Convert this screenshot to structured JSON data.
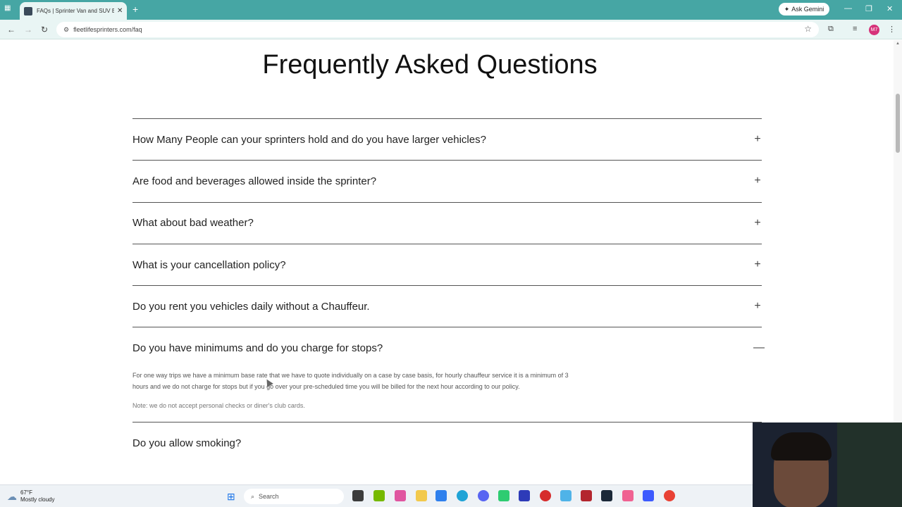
{
  "browser": {
    "tab_title": "FAQs | Sprinter Van and SUV Bl...",
    "tab_close": "✕",
    "new_tab": "+",
    "ask_gemini": "Ask Gemini",
    "url": "fleetlifesprinters.com/faq",
    "profile_initials": "M7",
    "minimize": "—",
    "restore": "❐",
    "close": "✕"
  },
  "page": {
    "title": "Frequently Asked Questions",
    "faqs": [
      {
        "question": "How Many People can your sprinters hold and do you have larger vehicles?",
        "toggle": "+"
      },
      {
        "question": "Are food and beverages allowed inside the sprinter?",
        "toggle": "+"
      },
      {
        "question": "What about bad weather?",
        "toggle": "+"
      },
      {
        "question": "What is your cancellation policy?",
        "toggle": "+"
      },
      {
        "question": "Do you rent you vehicles daily without a Chauffeur.",
        "toggle": "+"
      }
    ],
    "open_faq": {
      "question": "Do you have minimums and do you charge for stops?",
      "toggle": "—",
      "answer": "For one way trips we have a minimum base rate that we have to quote individually on a case by case basis, for hourly chauffeur service it is a minimum of 3 hours and we do not charge for stops but if you go over your pre-scheduled time you will be billed for the next hour according to our policy.",
      "note": "Note: we do not accept personal checks or diner's club cards."
    },
    "last_faq": {
      "question": "Do you allow smoking?"
    }
  },
  "taskbar": {
    "temperature": "67°F",
    "weather": "Mostly cloudy",
    "search_placeholder": "Search"
  }
}
